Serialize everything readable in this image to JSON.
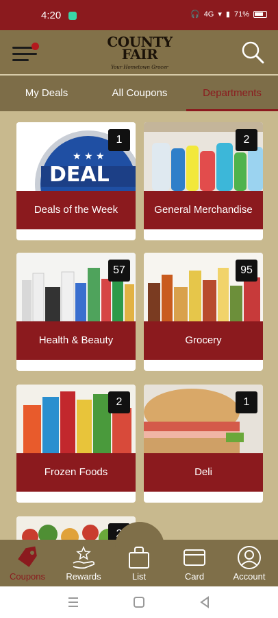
{
  "status_bar": {
    "time": "4:20",
    "battery": "71%",
    "network": "4G"
  },
  "header": {
    "logo_main": "COUNTY FAIR",
    "logo_line1": "COUNTY",
    "logo_line2": "FAIR",
    "logo_tagline": "Your Hometown Grocer"
  },
  "tabs": [
    {
      "label": "My Deals",
      "active": false
    },
    {
      "label": "All Coupons",
      "active": false
    },
    {
      "label": "Departments",
      "active": true
    }
  ],
  "departments": [
    {
      "label": "Deals of the Week",
      "count": "1",
      "image": "deal-week-badge"
    },
    {
      "label": "General Merchandise",
      "count": "2",
      "image": "cleaning-bottles"
    },
    {
      "label": "Health & Beauty",
      "count": "57",
      "image": "beauty-bottles"
    },
    {
      "label": "Grocery",
      "count": "95",
      "image": "pantry-jars"
    },
    {
      "label": "Frozen Foods",
      "count": "2",
      "image": "frozen-boxes"
    },
    {
      "label": "Deli",
      "count": "1",
      "image": "sandwich"
    },
    {
      "label": "",
      "count": "2",
      "image": "vegetables"
    }
  ],
  "bottom_nav": [
    {
      "label": "Coupons",
      "icon": "tag-icon",
      "active": true
    },
    {
      "label": "Rewards",
      "icon": "rewards-icon",
      "active": false
    },
    {
      "label": "List",
      "icon": "list-icon",
      "active": false
    },
    {
      "label": "Card",
      "icon": "card-icon",
      "active": false
    },
    {
      "label": "Account",
      "icon": "account-icon",
      "active": false
    }
  ],
  "colors": {
    "brand_red": "#8b1a1e",
    "header_tan": "#827149",
    "background": "#c8b98e"
  }
}
